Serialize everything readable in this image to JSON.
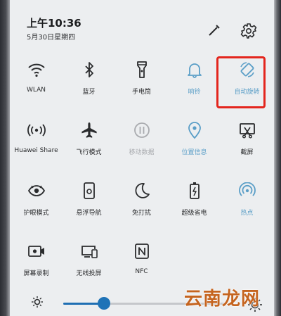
{
  "status": {
    "time": "上午10:36",
    "date": "5月30日星期四"
  },
  "header": {
    "edit_icon": "pencil-icon",
    "settings_icon": "gear-icon"
  },
  "tiles": [
    {
      "label": "WLAN",
      "icon": "wifi-icon",
      "state": "off"
    },
    {
      "label": "蓝牙",
      "icon": "bluetooth-icon",
      "state": "off"
    },
    {
      "label": "手电筒",
      "icon": "flashlight-icon",
      "state": "off"
    },
    {
      "label": "响铃",
      "icon": "bell-icon",
      "state": "on"
    },
    {
      "label": "自动旋转",
      "icon": "auto-rotate-icon",
      "state": "on"
    },
    {
      "label": "Huawei Share",
      "icon": "huawei-share-icon",
      "state": "off"
    },
    {
      "label": "飞行模式",
      "icon": "airplane-icon",
      "state": "off"
    },
    {
      "label": "移动数据",
      "icon": "mobile-data-icon",
      "state": "disabled"
    },
    {
      "label": "位置信息",
      "icon": "location-icon",
      "state": "on"
    },
    {
      "label": "截屏",
      "icon": "screenshot-icon",
      "state": "off"
    },
    {
      "label": "护眼模式",
      "icon": "eye-icon",
      "state": "off"
    },
    {
      "label": "悬浮导航",
      "icon": "floating-nav-icon",
      "state": "off"
    },
    {
      "label": "免打扰",
      "icon": "moon-icon",
      "state": "off"
    },
    {
      "label": "超级省电",
      "icon": "battery-icon",
      "state": "off"
    },
    {
      "label": "热点",
      "icon": "hotspot-icon",
      "state": "on"
    },
    {
      "label": "屏幕录制",
      "icon": "screen-record-icon",
      "state": "off"
    },
    {
      "label": "无线投屏",
      "icon": "wireless-projection-icon",
      "state": "off"
    },
    {
      "label": "NFC",
      "icon": "nfc-icon",
      "state": "off"
    }
  ],
  "brightness": {
    "level": 0.25
  },
  "watermark": "云南龙网",
  "colors": {
    "accent": "#5a9ec7",
    "highlight": "#e3251d",
    "slider": "#1f73b7"
  }
}
